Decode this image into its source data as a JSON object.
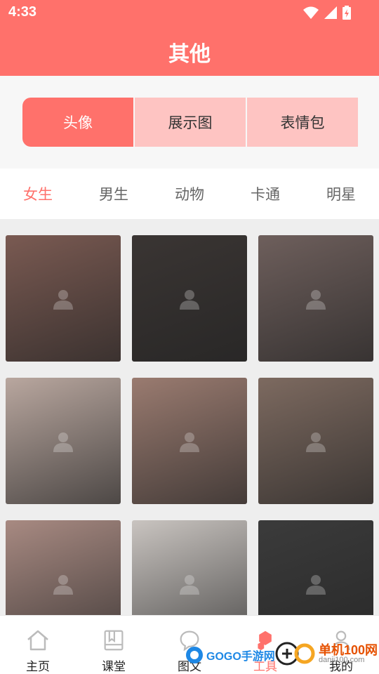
{
  "status": {
    "time": "4:33"
  },
  "header": {
    "title": "其他"
  },
  "segments": [
    {
      "label": "头像",
      "active": true
    },
    {
      "label": "展示图",
      "active": false
    },
    {
      "label": "表情包",
      "active": false
    }
  ],
  "tabs": [
    {
      "label": "女生",
      "active": true
    },
    {
      "label": "男生",
      "active": false
    },
    {
      "label": "动物",
      "active": false
    },
    {
      "label": "卡通",
      "active": false
    },
    {
      "label": "明星",
      "active": false
    }
  ],
  "tiles": [
    {
      "name": "avatar-girl-pigtails",
      "color": "#7a5a52"
    },
    {
      "name": "avatar-girl-with-cat",
      "color": "#3a3533"
    },
    {
      "name": "avatar-girl-hand-on-cheek",
      "color": "#6e5f5c"
    },
    {
      "name": "avatar-girl-headband",
      "color": "#b9a79f"
    },
    {
      "name": "avatar-girl-red-lips",
      "color": "#9a7b70"
    },
    {
      "name": "avatar-girl-blonde",
      "color": "#7d6a60"
    },
    {
      "name": "avatar-girl-roses",
      "color": "#a88a82"
    },
    {
      "name": "avatar-girl-beret",
      "color": "#c9c4c0"
    },
    {
      "name": "avatar-girl-monochrome",
      "color": "#3b3b3b"
    }
  ],
  "nav": [
    {
      "label": "主页",
      "icon": "home-icon",
      "active": false
    },
    {
      "label": "课堂",
      "icon": "book-icon",
      "active": false
    },
    {
      "label": "图文",
      "icon": "chat-icon",
      "active": false
    },
    {
      "label": "工具",
      "icon": "tools-icon",
      "active": true
    },
    {
      "label": "我的",
      "icon": "person-icon",
      "active": false
    }
  ],
  "watermark": {
    "left": "GOGO手游网",
    "right": "单机100网",
    "right_sub": "danji100.com"
  },
  "colors": {
    "accent": "#FF716B",
    "accent_light": "#FEC4C2"
  }
}
